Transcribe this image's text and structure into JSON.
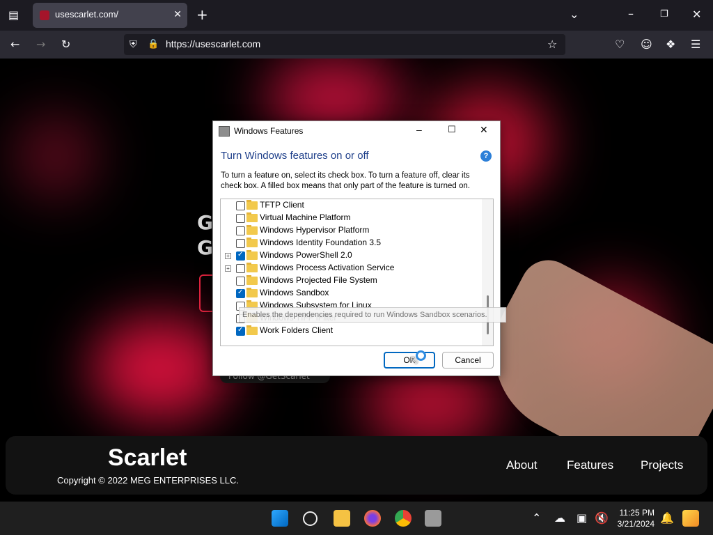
{
  "browser": {
    "tab_title": "usescarlet.com/",
    "url": "https://usescarlet.com"
  },
  "page": {
    "hero_lines": [
      "G",
      "G"
    ],
    "follow_text": "Follow @GetScarlet",
    "brand": "Scarlet",
    "copyright": "Copyright © 2022 MEG ENTERPRISES LLC.",
    "nav": [
      "About",
      "Features",
      "Projects"
    ]
  },
  "dialog": {
    "title": "Windows Features",
    "heading": "Turn Windows features on or off",
    "help_glyph": "?",
    "description": "To turn a feature on, select its check box. To turn a feature off, clear its check box. A filled box means that only part of the feature is turned on.",
    "features": [
      {
        "label": "TFTP Client",
        "checked": false,
        "expandable": false
      },
      {
        "label": "Virtual Machine Platform",
        "checked": false,
        "expandable": false
      },
      {
        "label": "Windows Hypervisor Platform",
        "checked": false,
        "expandable": false
      },
      {
        "label": "Windows Identity Foundation 3.5",
        "checked": false,
        "expandable": false
      },
      {
        "label": "Windows PowerShell 2.0",
        "checked": true,
        "expandable": true
      },
      {
        "label": "Windows Process Activation Service",
        "checked": false,
        "expandable": true
      },
      {
        "label": "Windows Projected File System",
        "checked": false,
        "expandable": false
      },
      {
        "label": "Windows Sandbox",
        "checked": true,
        "expandable": false
      },
      {
        "label": "Windows Subsystem for Linux",
        "checked": false,
        "expandable": false
      },
      {
        "label": "Windows TIFF IFilter",
        "checked": false,
        "expandable": false
      },
      {
        "label": "Work Folders Client",
        "checked": true,
        "expandable": false
      }
    ],
    "tooltip": "Enables the dependencies required to run Windows Sandbox scenarios.",
    "ok_label": "OK",
    "cancel_label": "Cancel"
  },
  "taskbar": {
    "time": "11:25 PM",
    "date": "3/21/2024"
  },
  "colors": {
    "accent": "#0067c0",
    "brand_red": "#e0233e",
    "heading_blue": "#1e3f8a"
  }
}
